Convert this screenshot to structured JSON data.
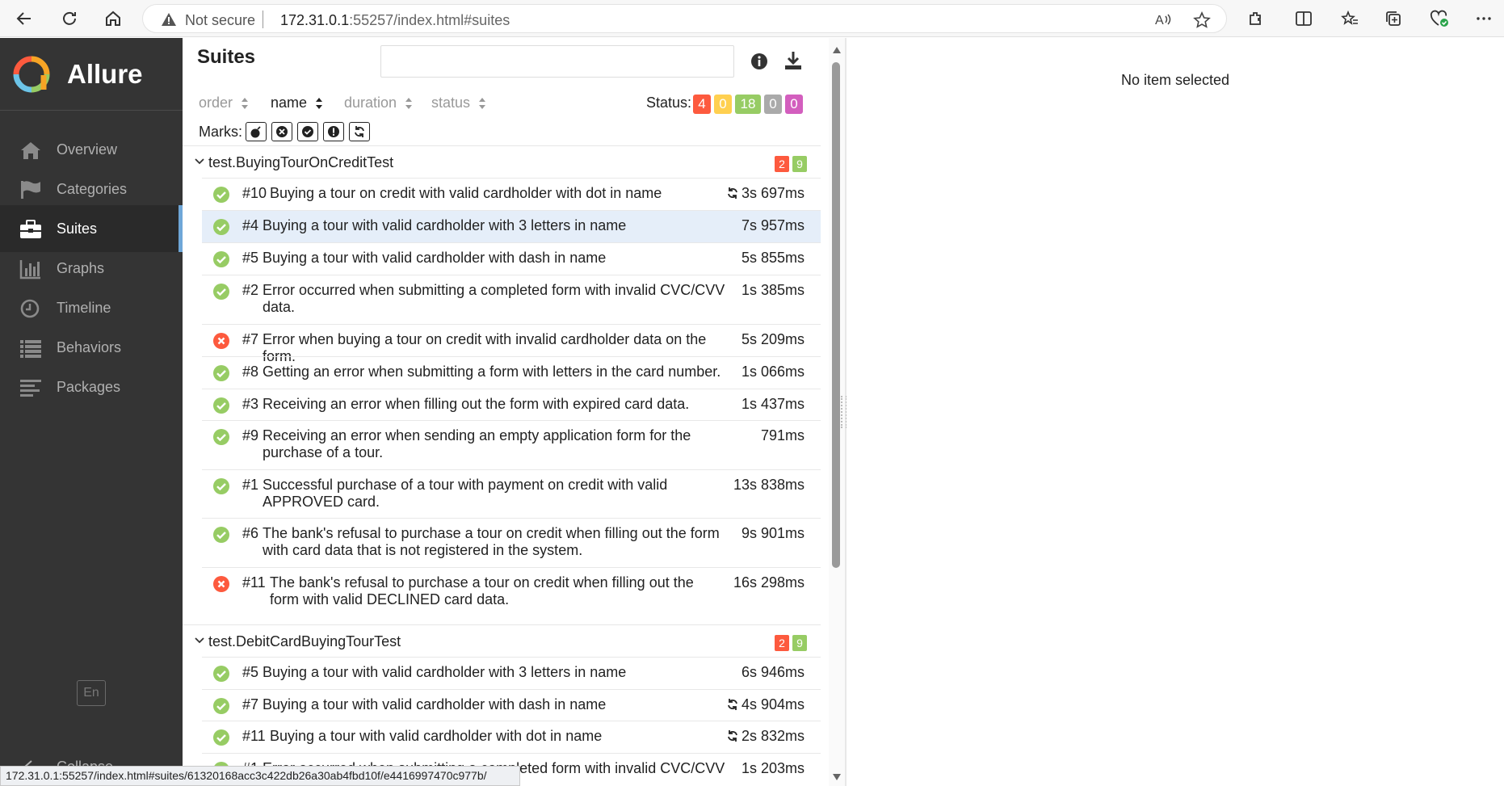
{
  "browser": {
    "security": "Not secure",
    "url_host": "172.31.0.1",
    "url_rest": ":55257/index.html#suites",
    "status_url": "172.31.0.1:55257/index.html#suites/61320168acc3c422db26a30ab4fbd10f/e4416997470c977b/"
  },
  "sidebar": {
    "brand": "Allure",
    "items": [
      {
        "label": "Overview",
        "icon": "home-icon"
      },
      {
        "label": "Categories",
        "icon": "flag-icon"
      },
      {
        "label": "Suites",
        "icon": "briefcase-icon"
      },
      {
        "label": "Graphs",
        "icon": "bar-chart-icon"
      },
      {
        "label": "Timeline",
        "icon": "clock-icon"
      },
      {
        "label": "Behaviors",
        "icon": "list-icon"
      },
      {
        "label": "Packages",
        "icon": "align-left-icon"
      }
    ],
    "lang": "En",
    "collapse": "Collapse"
  },
  "main": {
    "title": "Suites",
    "sort": {
      "order": "order",
      "name": "name",
      "duration": "duration",
      "status": "status"
    },
    "status_label": "Status:",
    "status_counts": {
      "failed": "4",
      "broken": "0",
      "passed": "18",
      "skipped": "0",
      "unknown": "0"
    },
    "marks_label": "Marks:",
    "groups": [
      {
        "name": "test.BuyingTourOnCreditTest",
        "failed": "2",
        "passed": "9",
        "rows": [
          {
            "num": "#10",
            "name": "Buying a tour on credit with valid cardholder with dot in name",
            "dur": "3s 697ms",
            "status": "passed",
            "retry": true
          },
          {
            "num": "#4",
            "name": "Buying a tour with valid cardholder with 3 letters in name",
            "dur": "7s 957ms",
            "status": "passed",
            "retry": false
          },
          {
            "num": "#5",
            "name": "Buying a tour with valid cardholder with dash in name",
            "dur": "5s 855ms",
            "status": "passed",
            "retry": false
          },
          {
            "num": "#2",
            "name": "Error occurred when submitting a completed form with invalid CVC/CVV data.",
            "dur": "1s 385ms",
            "status": "passed",
            "retry": false
          },
          {
            "num": "#7",
            "name": "Error when buying a tour on credit with invalid cardholder data on the form.",
            "dur": "5s 209ms",
            "status": "failed",
            "retry": false
          },
          {
            "num": "#8",
            "name": "Getting an error when submitting a form with letters in the card number.",
            "dur": "1s 066ms",
            "status": "passed",
            "retry": false
          },
          {
            "num": "#3",
            "name": "Receiving an error when filling out the form with expired card data.",
            "dur": "1s 437ms",
            "status": "passed",
            "retry": false
          },
          {
            "num": "#9",
            "name": "Receiving an error when sending an empty application form for the purchase of a tour.",
            "dur": "791ms",
            "status": "passed",
            "retry": false
          },
          {
            "num": "#1",
            "name": "Successful purchase of a tour with payment on credit with valid APPROVED card.",
            "dur": "13s 838ms",
            "status": "passed",
            "retry": false
          },
          {
            "num": "#6",
            "name": "The bank's refusal to purchase a tour on credit when filling out the form with card data that is not registered in the system.",
            "dur": "9s 901ms",
            "status": "passed",
            "retry": false
          },
          {
            "num": "#11",
            "name": "The bank's refusal to purchase a tour on credit when filling out the form with valid DECLINED card data.",
            "dur": "16s 298ms",
            "status": "failed",
            "retry": false
          }
        ]
      },
      {
        "name": "test.DebitCardBuyingTourTest",
        "failed": "2",
        "passed": "9",
        "rows": [
          {
            "num": "#5",
            "name": "Buying a tour with valid cardholder with 3 letters in name",
            "dur": "6s 946ms",
            "status": "passed",
            "retry": false
          },
          {
            "num": "#7",
            "name": "Buying a tour with valid cardholder with dash in name",
            "dur": "4s 904ms",
            "status": "passed",
            "retry": true
          },
          {
            "num": "#11",
            "name": "Buying a tour with valid cardholder with dot in name",
            "dur": "2s 832ms",
            "status": "passed",
            "retry": true
          },
          {
            "num": "#1",
            "name": "Error occurred when submitting a completed form with invalid CVC/CVV",
            "dur": "1s 203ms",
            "status": "passed",
            "retry": false
          }
        ]
      }
    ]
  },
  "detail": {
    "empty": "No item selected"
  },
  "colors": {
    "failed": "#fd5a3e",
    "broken": "#ffd050",
    "passed": "#97cc64",
    "skipped": "#aaaaaa",
    "unknown": "#d35ebe",
    "accent": "#6fa7d8"
  }
}
